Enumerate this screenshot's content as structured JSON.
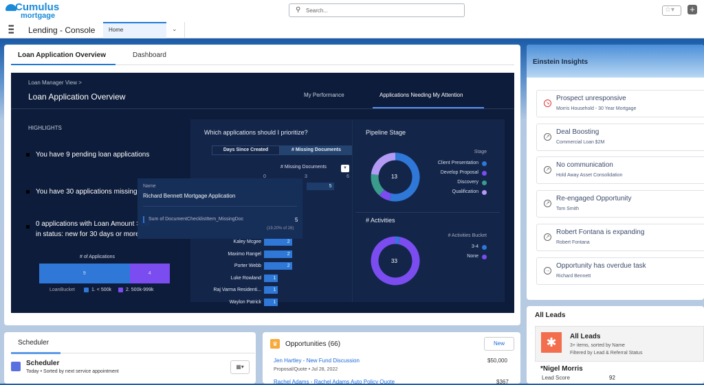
{
  "brand": {
    "line1": "Cumulus",
    "line2": "mortgage"
  },
  "search": {
    "placeholder": "Search..."
  },
  "nav": {
    "app_name": "Lending - Console",
    "tab": "Home"
  },
  "main_tabs": [
    "Loan Application Overview",
    "Dashboard"
  ],
  "dashboard": {
    "breadcrumb": "Loan Manager View >",
    "title": "Loan Application Overview",
    "tabs": [
      "My Performance",
      "Applications Needing My Attention"
    ],
    "highlights_label": "HIGHLIGHTS",
    "highlights": [
      "You have 9 pending loan applications",
      "You have 30 applications missing do",
      "0 applications with Loan Amount >1M",
      "in status: new for 30 days or more"
    ],
    "stacked": {
      "title": "# of Applications",
      "legend_label": "LoanBucket",
      "series": [
        {
          "name": "1. < 500k",
          "value": 9,
          "color": "#2f78d8"
        },
        {
          "name": "2. 500k-999k",
          "value": 4,
          "color": "#7b4cf0"
        }
      ]
    },
    "prioritize": {
      "title": "Which applications should I prioritize?",
      "toggle": [
        "Days Since Created",
        "# Missing Documents"
      ],
      "axis_label": "# Missing Documents",
      "ticks": [
        "0",
        "3",
        "6"
      ],
      "rows": [
        {
          "name": "Richard Bennett Mortgage Application",
          "value": 5
        },
        {
          "name": "Kaley Mcgee",
          "value": 2
        },
        {
          "name": "Maximo Rangel",
          "value": 2
        },
        {
          "name": "Porter Webb",
          "value": 2
        },
        {
          "name": "Luke Rowland",
          "value": 1
        },
        {
          "name": "Raj Varma Residenti...",
          "value": 1
        },
        {
          "name": "Waylon Patrick",
          "value": 1
        }
      ],
      "top_value": "5"
    },
    "tooltip": {
      "name_label": "Name",
      "name": "Richard Bennett Mortgage Application",
      "metric": "Sum of DocumentChecklistItem_MissingDoc",
      "value": "5",
      "pct": "(19.20% of 26)"
    },
    "pipeline": {
      "title": "Pipeline Stage",
      "legend_title": "Stage",
      "total": "13",
      "slices": [
        {
          "name": "Client Presentation",
          "value": 7,
          "color": "#2f78d8"
        },
        {
          "name": "Develop Proposal",
          "value": 1,
          "color": "#7b4cf0"
        },
        {
          "name": "Discovery",
          "value": 2,
          "color": "#3a9d8c"
        },
        {
          "name": "Qualification",
          "value": 3,
          "color": "#b39af5"
        }
      ]
    },
    "activities": {
      "title": "# Activities",
      "legend_title": "# Activities Bucket",
      "total": "33",
      "slices": [
        {
          "name": "3-4",
          "value": 1,
          "color": "#2f78d8"
        },
        {
          "name": "None",
          "value": 32,
          "color": "#7b4cf0"
        }
      ]
    }
  },
  "einstein": {
    "title": "Einstein Insights",
    "items": [
      {
        "title": "Prospect unresponsive",
        "sub": "Morris Household - 30 Year Mortgage",
        "icon": "trend-down-icon"
      },
      {
        "title": "Deal Boosting",
        "sub": "Commercial Loan $2M",
        "icon": "trend-up-icon"
      },
      {
        "title": "No communication",
        "sub": "Hold Away Asset Consolidation",
        "icon": "trend-up-icon"
      },
      {
        "title": "Re-engaged Opportunity",
        "sub": "Tom Smith",
        "icon": "trend-up-icon"
      },
      {
        "title": "Robert Fontana is expanding",
        "sub": "Robert Fontana",
        "icon": "trend-up-icon"
      },
      {
        "title": "Opportunity has overdue task",
        "sub": "Richard Bennett",
        "icon": "arrow-right-icon"
      }
    ]
  },
  "leads": {
    "header": "All Leads",
    "title": "All Leads",
    "sub1": "3+ items, sorted by Name",
    "sub2": "Filtered by Lead & Referral Status",
    "first": "*Nigel Morris",
    "score_label": "Lead Score",
    "score": "92"
  },
  "scheduler": {
    "tab": "Scheduler",
    "title": "Scheduler",
    "sub": "Today  •  Sorted by next service appointment"
  },
  "opps": {
    "title": "Opportunities (66)",
    "new_label": "New",
    "items": [
      {
        "name": "Jen Hartley - New Fund Discussion",
        "meta": "Proposal/Quote  •  Jul 28, 2022",
        "amount": "$50,000"
      },
      {
        "name": "Rachel Adams - Rachel Adams Auto Policy Quote",
        "amount": "$367"
      }
    ]
  }
}
